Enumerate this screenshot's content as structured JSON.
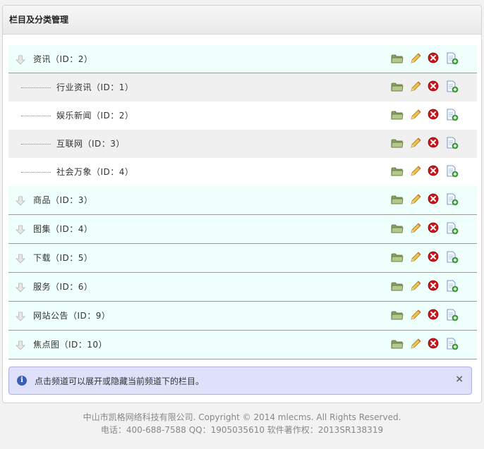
{
  "panel": {
    "title": "栏目及分类管理"
  },
  "categories": [
    {
      "name": "资讯（ID：2）"
    },
    {
      "name": "行业资讯（ID：1）"
    },
    {
      "name": "娱乐新闻（ID：2）"
    },
    {
      "name": "互联网（ID：3）"
    },
    {
      "name": "社会万象（ID：4）"
    },
    {
      "name": "商品（ID：3）"
    },
    {
      "name": "图集（ID：4）"
    },
    {
      "name": "下载（ID：5）"
    },
    {
      "name": "服务（ID：6）"
    },
    {
      "name": "网站公告（ID：9）"
    },
    {
      "name": "焦点图（ID：10）"
    }
  ],
  "icons": {
    "expand": "arrow-down-icon",
    "open": "folder-icon",
    "edit": "pencil-icon",
    "delete": "delete-icon",
    "add": "add-document-icon"
  },
  "colors": {
    "parent_row_bg": "#effffb",
    "notice_bg": "#dfe1fb",
    "delete_red": "#c8161d"
  },
  "notice": {
    "text": "点击频道可以展开或隐藏当前频道下的栏目。",
    "close": "×"
  },
  "footer": {
    "line1": "中山市凯格网络科技有限公司. Copyright © 2014 mlecms. All Rights Reserved.",
    "line2": "电话：400-688-7588  QQ：1905035610  软件著作权：2013SR138319"
  }
}
